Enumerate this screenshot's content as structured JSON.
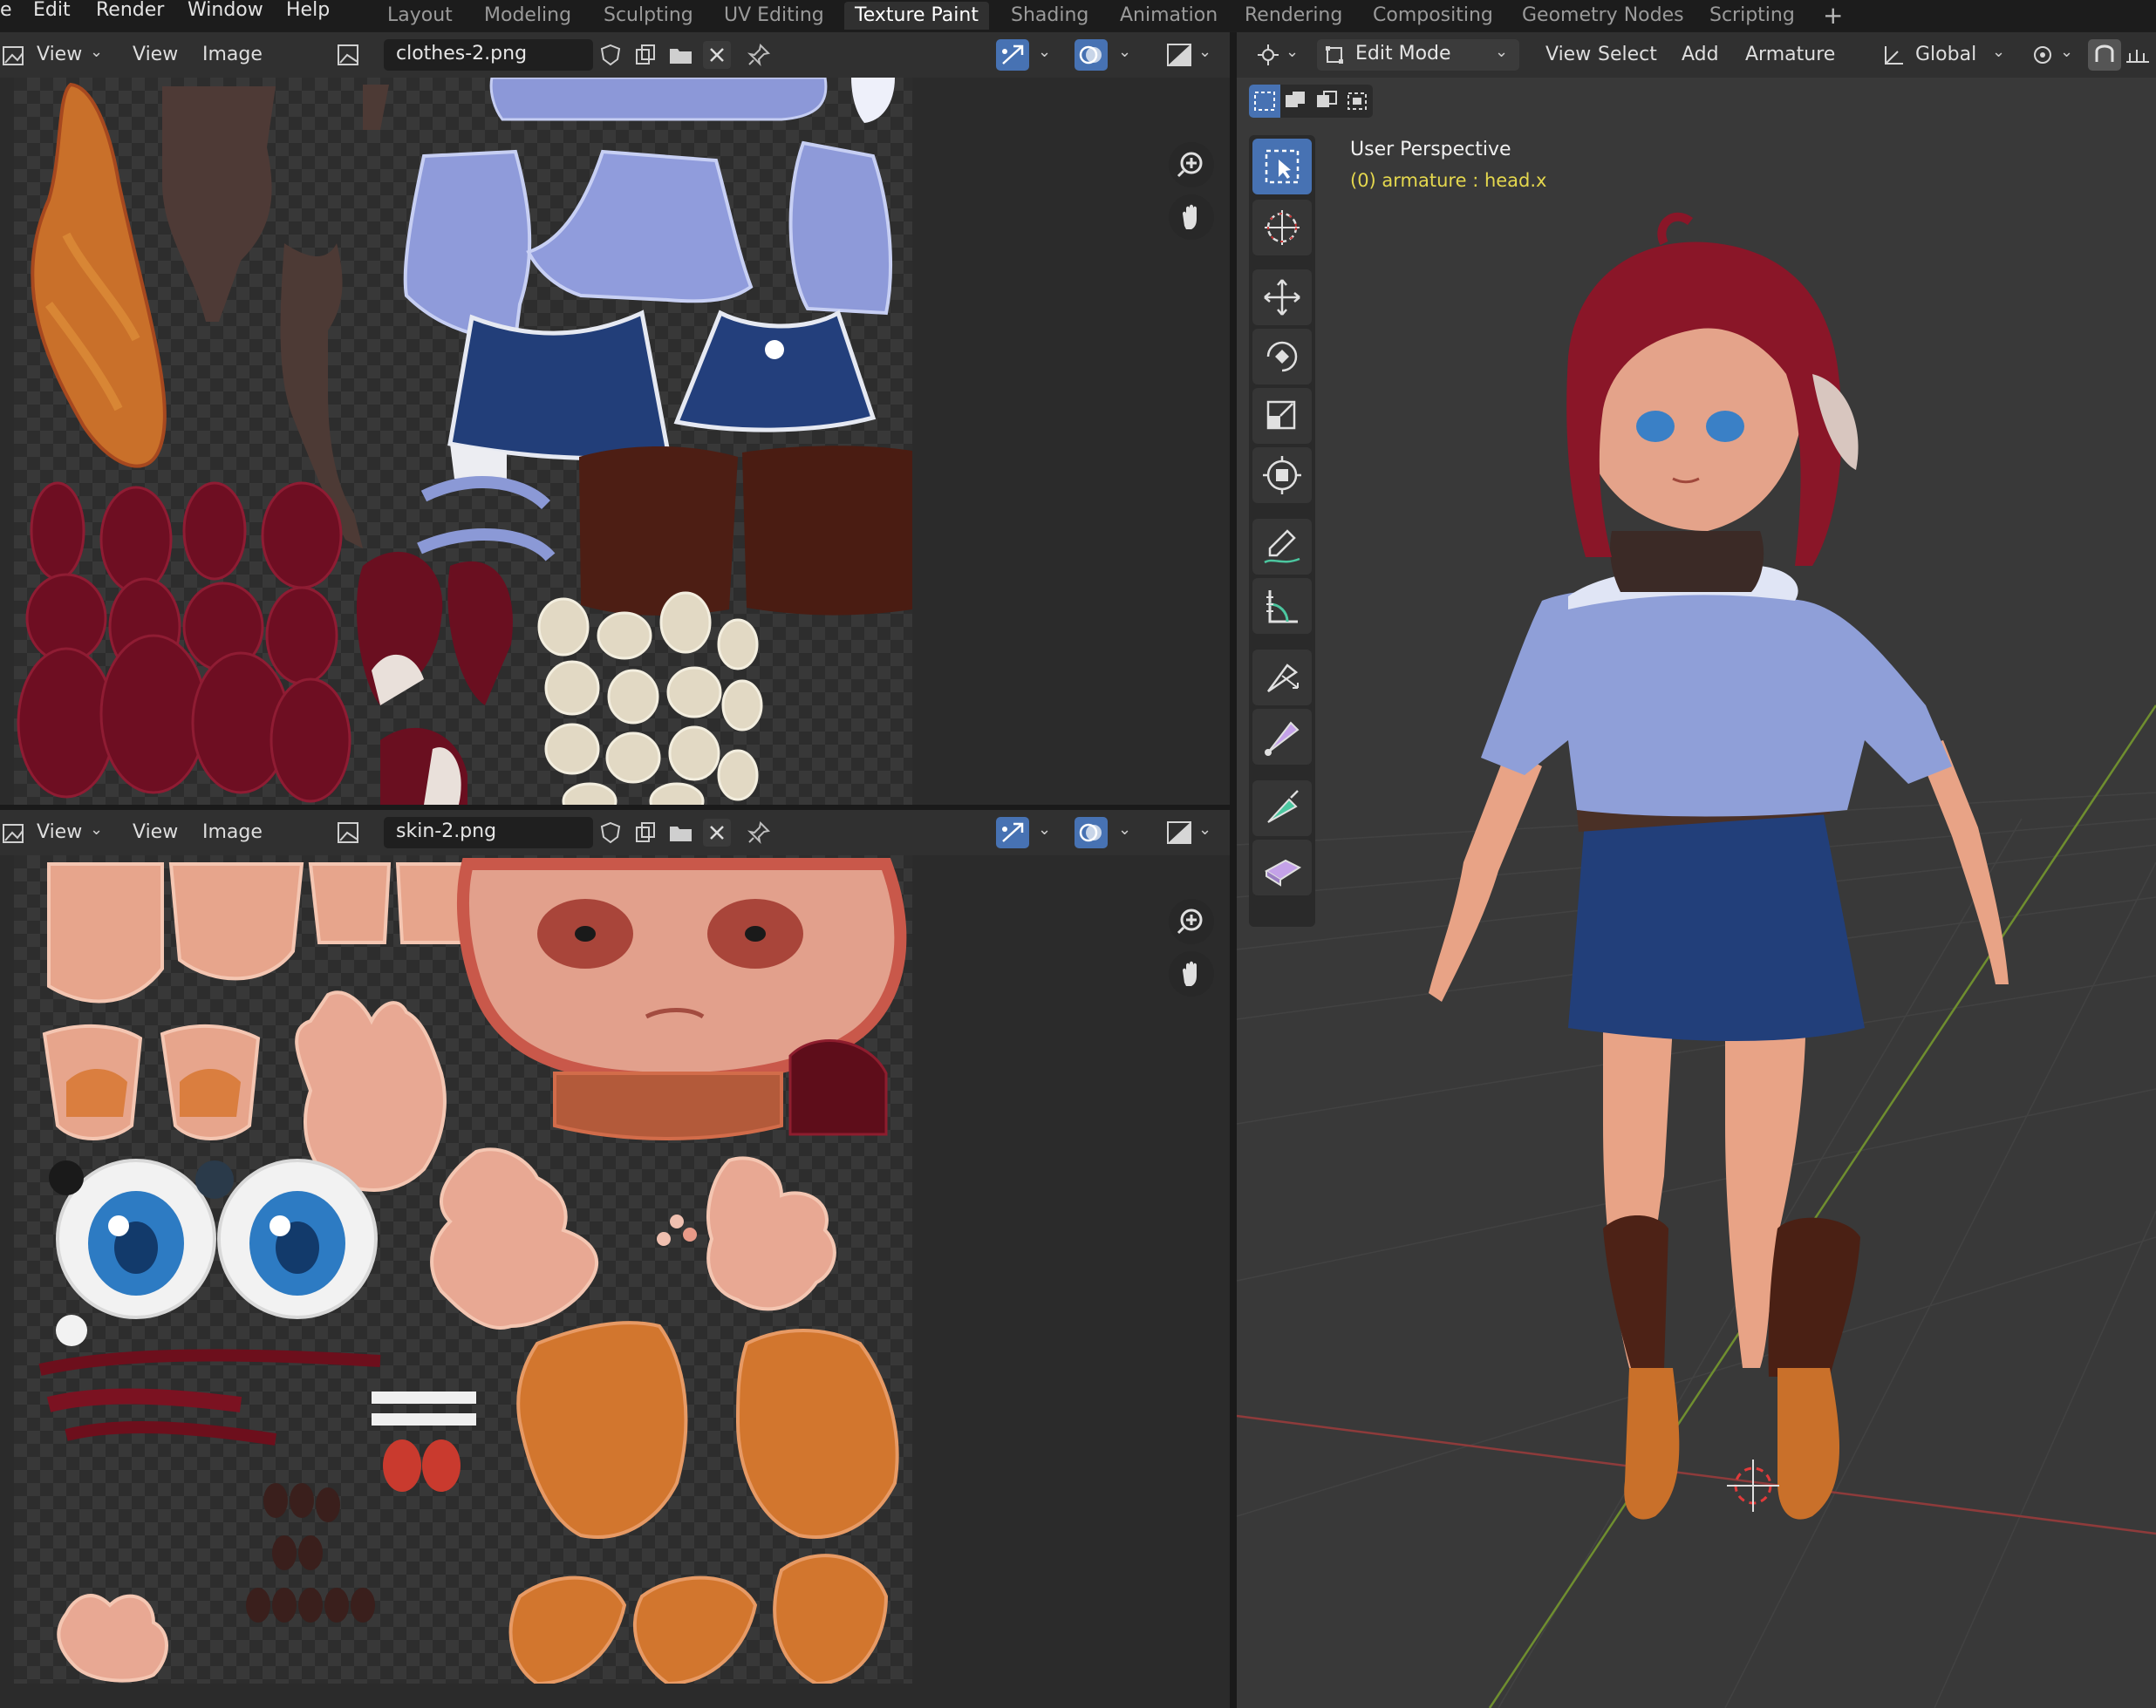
{
  "topbar": {
    "menus": [
      "e",
      "Edit",
      "Render",
      "Window",
      "Help"
    ],
    "workspaces": [
      "Layout",
      "Modeling",
      "Sculpting",
      "UV Editing",
      "Texture Paint",
      "Shading",
      "Animation",
      "Rendering",
      "Compositing",
      "Geometry Nodes",
      "Scripting"
    ],
    "add_workspace": "+"
  },
  "image_editor_top": {
    "view_menu": "View",
    "view2": "View",
    "image_menu": "Image",
    "image_name": "clothes-2.png"
  },
  "image_editor_bottom": {
    "view_menu": "View",
    "view2": "View",
    "image_menu": "Image",
    "image_name": "skin-2.png"
  },
  "viewport": {
    "mode": "Edit Mode",
    "menus": [
      "View",
      "Select",
      "Add",
      "Armature"
    ],
    "orientation": "Global",
    "perspective": "User Perspective",
    "object_info": "(0) armature : head.x"
  },
  "colors": {
    "accent": "#4772b3",
    "info_text": "#e5d84e"
  },
  "icons": {
    "zoom": "zoom-in-icon",
    "pan": "hand-icon",
    "select_box": "select-box-icon",
    "cursor": "cursor-icon",
    "move": "move-icon",
    "rotate": "rotate-icon",
    "scale": "scale-icon",
    "transform": "transform-icon",
    "annotate": "annotate-icon",
    "measure": "measure-icon",
    "bone_size": "bone-size-icon",
    "bone_envelope": "bone-envelope-icon",
    "extrude": "extrude-icon",
    "roll": "roll-icon"
  }
}
